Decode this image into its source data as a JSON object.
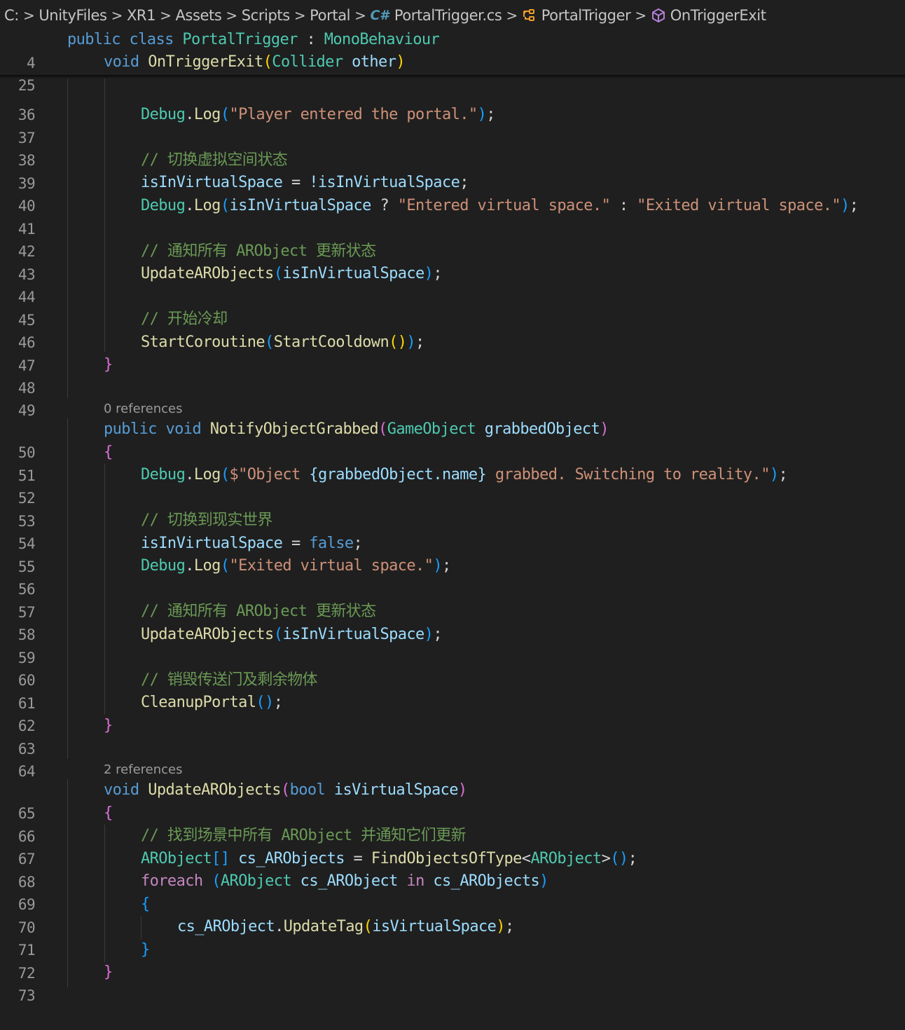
{
  "breadcrumb": {
    "drive": "C:",
    "folders": [
      "UnityFiles",
      "XR1",
      "Assets",
      "Scripts",
      "Portal"
    ],
    "file": "PortalTrigger.cs",
    "file_icon": "csharp-file-icon",
    "class": "PortalTrigger",
    "class_icon": "class-icon",
    "method": "OnTriggerExit",
    "method_icon": "method-icon",
    "separator": ">"
  },
  "sticky": [
    {
      "num": "4",
      "class_kw": "public class",
      "class_name": "PortalTrigger",
      "colon": ":",
      "base": "MonoBehaviour"
    },
    {
      "num": "25",
      "kw": "void",
      "method": "OnTriggerExit",
      "type": "Collider",
      "param": "other"
    }
  ],
  "lines": {
    "l36": {
      "num": "36"
    },
    "l37": {
      "num": "37",
      "fn": "Debug",
      "m": "Log",
      "str": "\"Player entered the portal.\""
    },
    "l38": {
      "num": "38"
    },
    "l39": {
      "num": "39",
      "comment": "// 切换虚拟空间状态"
    },
    "l40": {
      "num": "40",
      "lhs": "isInVirtualSpace",
      "rhs": "!isInVirtualSpace"
    },
    "l41": {
      "num": "41",
      "fn": "Debug",
      "m": "Log",
      "var": "isInVirtualSpace",
      "s1": "\"Entered virtual space.\"",
      "s2": "\"Exited virtual space.\""
    },
    "l42": {
      "num": "42"
    },
    "l43": {
      "num": "43",
      "comment": "// 通知所有 ARObject 更新状态"
    },
    "l44": {
      "num": "44",
      "fn": "UpdateARObjects",
      "arg": "isInVirtualSpace"
    },
    "l45": {
      "num": "45"
    },
    "l46": {
      "num": "46",
      "comment": "// 开始冷却"
    },
    "l47": {
      "num": "47",
      "fn": "StartCoroutine",
      "inner": "StartCooldown"
    },
    "l48": {
      "num": "48",
      "brace": "}"
    },
    "l49": {
      "num": "49"
    },
    "l50": {
      "num": "50",
      "kw": "public void",
      "fn": "NotifyObjectGrabbed",
      "type": "GameObject",
      "param": "grabbedObject"
    },
    "l51": {
      "num": "51",
      "brace": "{"
    },
    "l52": {
      "num": "52",
      "fn": "Debug",
      "m": "Log",
      "s_a": "$\"Object ",
      "interp": "{grabbedObject.name}",
      "s_b": " grabbed. Switching to reality.\""
    },
    "l53": {
      "num": "53"
    },
    "l54": {
      "num": "54",
      "comment": "// 切换到现实世界"
    },
    "l55": {
      "num": "55",
      "lhs": "isInVirtualSpace",
      "rhs": "false"
    },
    "l56": {
      "num": "56",
      "fn": "Debug",
      "m": "Log",
      "str": "\"Exited virtual space.\""
    },
    "l57": {
      "num": "57"
    },
    "l58": {
      "num": "58",
      "comment": "// 通知所有 ARObject 更新状态"
    },
    "l59": {
      "num": "59",
      "fn": "UpdateARObjects",
      "arg": "isInVirtualSpace"
    },
    "l60": {
      "num": "60"
    },
    "l61": {
      "num": "61",
      "comment": "// 销毁传送门及剩余物体"
    },
    "l62": {
      "num": "62",
      "fn": "CleanupPortal"
    },
    "l63": {
      "num": "63",
      "brace": "}"
    },
    "l64": {
      "num": "64"
    },
    "l65": {
      "num": "65",
      "kw": "void",
      "fn": "UpdateARObjects",
      "type": "bool",
      "param": "isVirtualSpace"
    },
    "l66": {
      "num": "66",
      "brace": "{"
    },
    "l67": {
      "num": "67",
      "comment": "// 找到场景中所有 ARObject 并通知它们更新"
    },
    "l68": {
      "num": "68",
      "type": "ARObject",
      "var": "cs_ARObjects",
      "fn": "FindObjectsOfType",
      "generic": "ARObject"
    },
    "l69": {
      "num": "69",
      "kw": "foreach",
      "type": "ARObject",
      "var": "cs_ARObject",
      "in": "in",
      "coll": "cs_ARObjects"
    },
    "l70": {
      "num": "70",
      "brace": "{"
    },
    "l71": {
      "num": "71",
      "obj": "cs_ARObject",
      "m": "UpdateTag",
      "arg": "isVirtualSpace"
    },
    "l72": {
      "num": "72",
      "brace": "}"
    },
    "l73": {
      "num": "73",
      "brace": "}"
    }
  },
  "codelens": {
    "notify": "0 references",
    "update": "2 references"
  }
}
